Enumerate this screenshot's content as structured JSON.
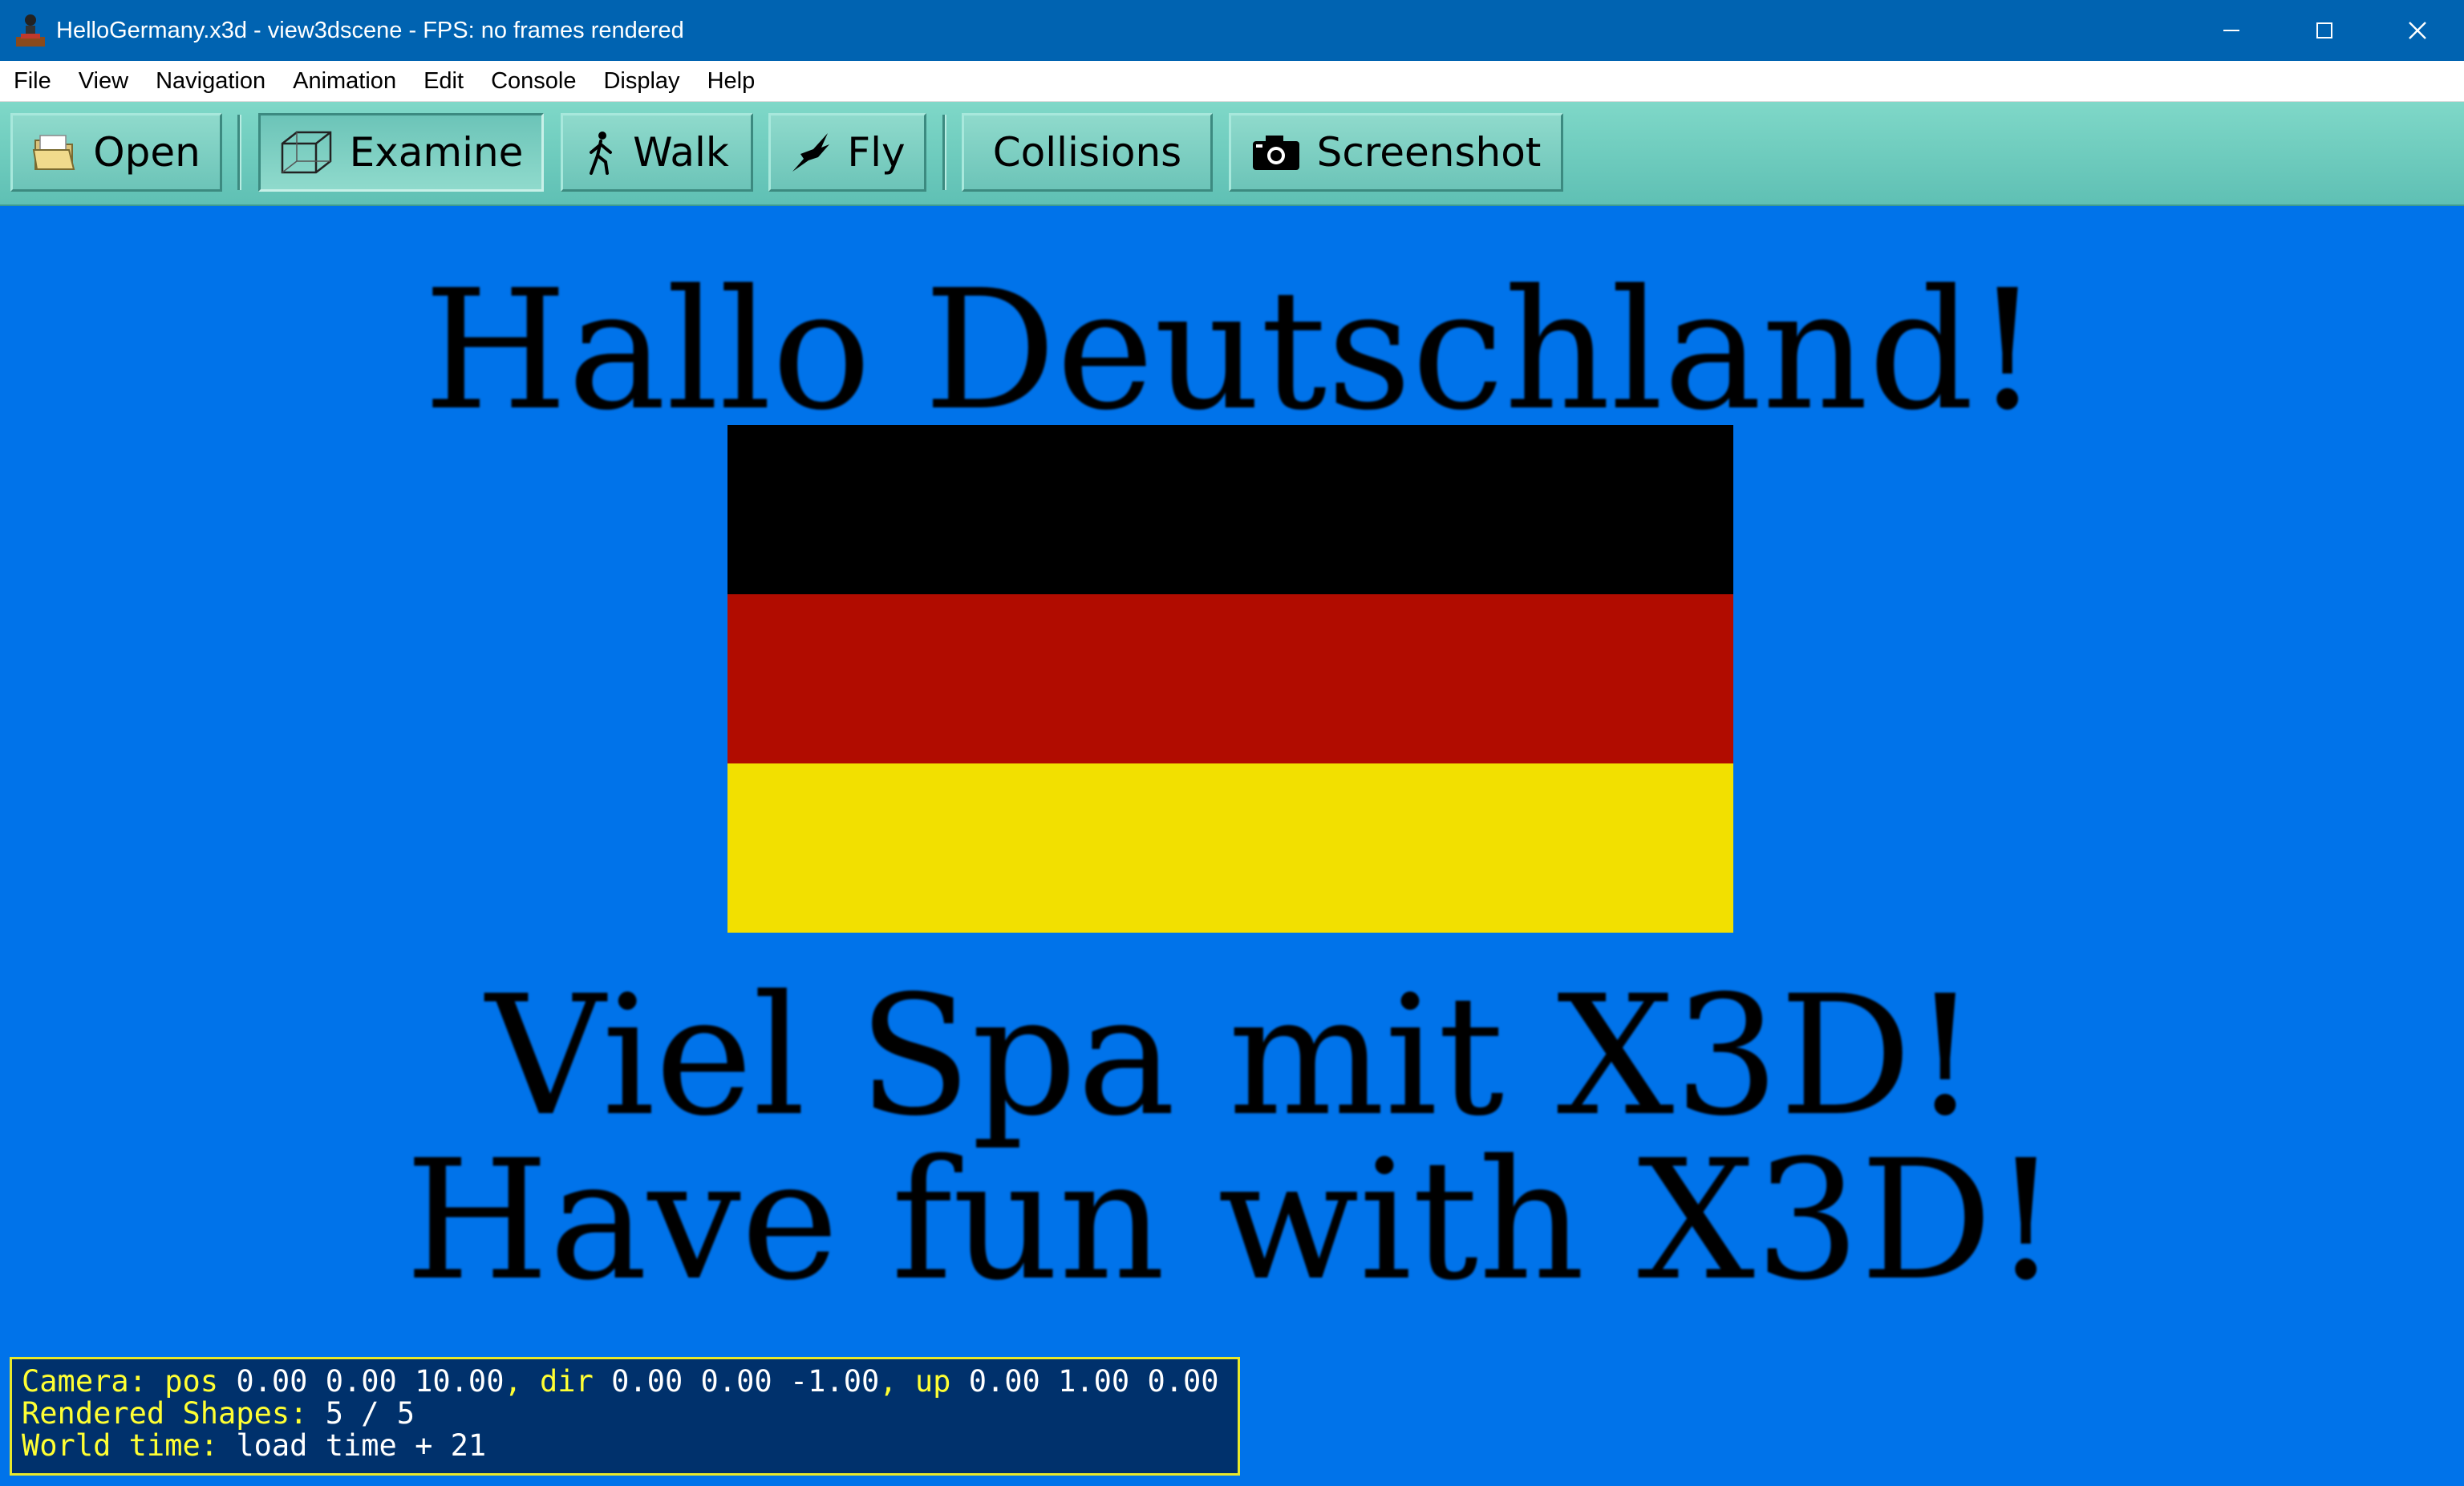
{
  "window": {
    "title": "HelloGermany.x3d - view3dscene - FPS: no frames rendered",
    "controls": [
      "minimize-icon",
      "maximize-icon",
      "close-icon"
    ]
  },
  "menu": [
    "File",
    "View",
    "Navigation",
    "Animation",
    "Edit",
    "Console",
    "Display",
    "Help"
  ],
  "toolbar": {
    "open": "Open",
    "examine": "Examine",
    "walk": "Walk",
    "fly": "Fly",
    "collisions": "Collisions",
    "screenshot": "Screenshot",
    "active_mode": "Examine"
  },
  "scene": {
    "background": "#0073ea",
    "heading": "Hallo Deutschland!",
    "line1": "Viel Spa mit X3D!",
    "line2": "Have fun with X3D!",
    "flag_colors": [
      "#000000",
      "#b10c00",
      "#f2e000"
    ]
  },
  "status": {
    "camera_label": "Camera:",
    "pos_label": "pos",
    "pos_value": "0.00 0.00 10.00",
    "dir_label": "dir",
    "dir_value": "0.00 0.00 -1.00",
    "up_label": "up",
    "up_value": "0.00 1.00 0.00",
    "shapes_label": "Rendered Shapes:",
    "shapes_value": "5 / 5",
    "time_label": "World time:",
    "time_value": "load time + 21"
  }
}
